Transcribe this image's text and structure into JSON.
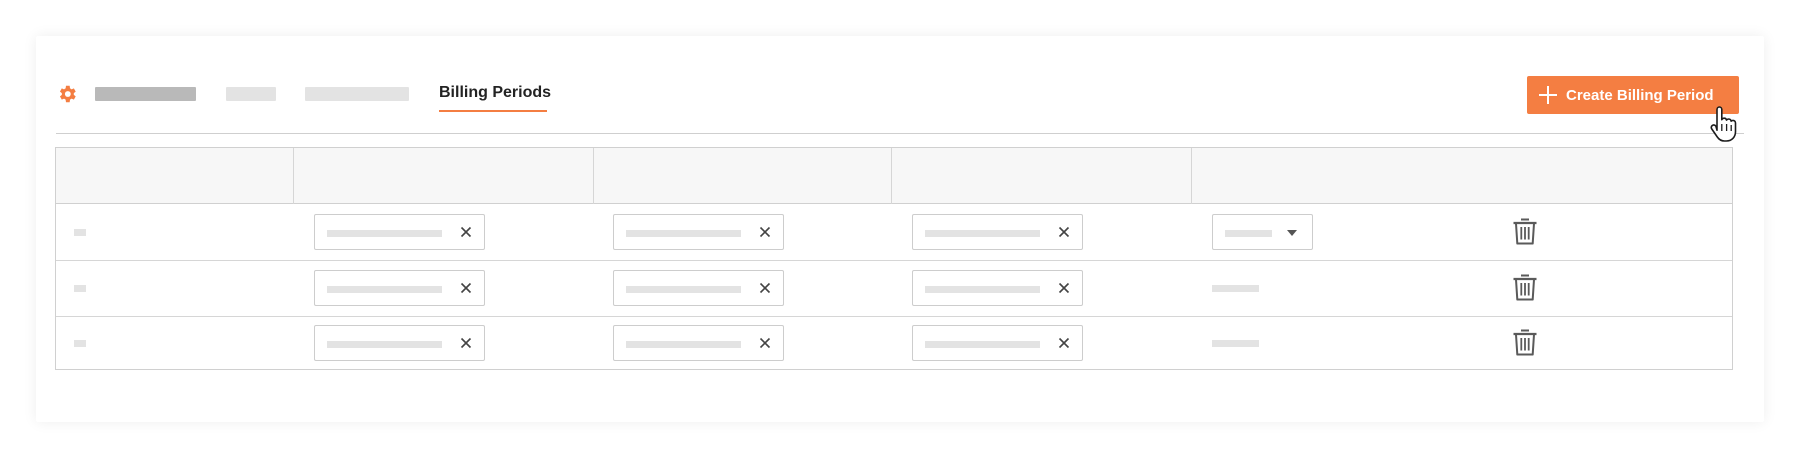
{
  "tabs": {
    "active_label": "Billing Periods"
  },
  "toolbar": {
    "create_label": "Create Billing Period",
    "create_icon": "plus-icon"
  },
  "colors": {
    "accent": "#f47e42",
    "placeholder_dark": "#b7b7b7",
    "placeholder_light": "#e3e3e3"
  },
  "icons": {
    "settings": "gear-icon",
    "clear": "close-icon",
    "delete": "trash-icon",
    "dropdown": "caret-down-icon",
    "cursor": "hand-pointer-icon"
  }
}
